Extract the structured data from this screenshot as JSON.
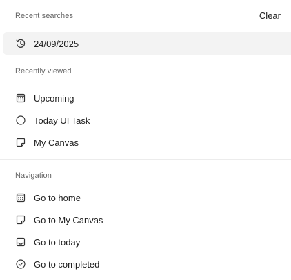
{
  "recent_searches": {
    "header": "Recent searches",
    "clear_label": "Clear",
    "items": [
      {
        "label": "24/09/2025",
        "icon": "history-icon"
      }
    ]
  },
  "recently_viewed": {
    "header": "Recently viewed",
    "items": [
      {
        "label": "Upcoming",
        "icon": "calendar-icon"
      },
      {
        "label": "Today UI Task",
        "icon": "circle-icon"
      },
      {
        "label": "My Canvas",
        "icon": "note-icon"
      }
    ]
  },
  "navigation": {
    "header": "Navigation",
    "items": [
      {
        "label": "Go to home",
        "icon": "calendar-icon"
      },
      {
        "label": "Go to My Canvas",
        "icon": "note-icon"
      },
      {
        "label": "Go to today",
        "icon": "inbox-icon"
      },
      {
        "label": "Go to completed",
        "icon": "check-circle-icon"
      }
    ]
  },
  "colors": {
    "highlight": "#f3f3f3",
    "text": "#202020",
    "muted": "#666666",
    "divider": "#ececec"
  }
}
